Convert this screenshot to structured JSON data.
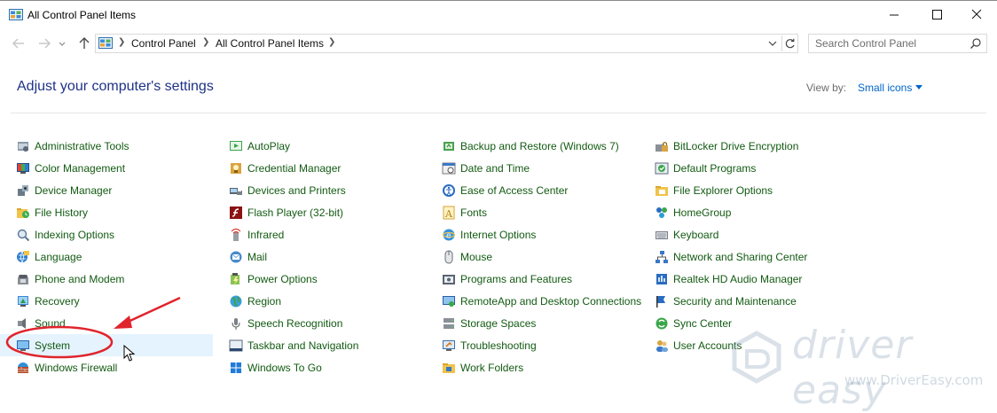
{
  "window": {
    "title": "All Control Panel Items",
    "controls": [
      "minimize-icon",
      "maximize-icon",
      "close-icon"
    ]
  },
  "address": {
    "breadcrumbs": [
      "Control Panel",
      "All Control Panel Items"
    ],
    "search_placeholder": "Search Control Panel"
  },
  "header": {
    "heading": "Adjust your computer's settings",
    "view_by_label": "View by:",
    "view_by_value": "Small icons"
  },
  "columns": [
    [
      {
        "label": "Administrative Tools",
        "icon": "admin-tools-icon"
      },
      {
        "label": "Color Management",
        "icon": "color-management-icon"
      },
      {
        "label": "Device Manager",
        "icon": "device-manager-icon"
      },
      {
        "label": "File History",
        "icon": "file-history-icon"
      },
      {
        "label": "Indexing Options",
        "icon": "indexing-options-icon"
      },
      {
        "label": "Language",
        "icon": "language-icon"
      },
      {
        "label": "Phone and Modem",
        "icon": "phone-modem-icon"
      },
      {
        "label": "Recovery",
        "icon": "recovery-icon"
      },
      {
        "label": "Sound",
        "icon": "sound-icon"
      },
      {
        "label": "System",
        "icon": "system-icon",
        "selected": true
      },
      {
        "label": "Windows Firewall",
        "icon": "firewall-icon"
      }
    ],
    [
      {
        "label": "AutoPlay",
        "icon": "autoplay-icon"
      },
      {
        "label": "Credential Manager",
        "icon": "credential-manager-icon"
      },
      {
        "label": "Devices and Printers",
        "icon": "devices-printers-icon"
      },
      {
        "label": "Flash Player (32-bit)",
        "icon": "flash-player-icon"
      },
      {
        "label": "Infrared",
        "icon": "infrared-icon"
      },
      {
        "label": "Mail",
        "icon": "mail-icon"
      },
      {
        "label": "Power Options",
        "icon": "power-options-icon"
      },
      {
        "label": "Region",
        "icon": "region-icon"
      },
      {
        "label": "Speech Recognition",
        "icon": "speech-recognition-icon"
      },
      {
        "label": "Taskbar and Navigation",
        "icon": "taskbar-icon"
      },
      {
        "label": "Windows To Go",
        "icon": "windows-to-go-icon"
      }
    ],
    [
      {
        "label": "Backup and Restore (Windows 7)",
        "icon": "backup-restore-icon"
      },
      {
        "label": "Date and Time",
        "icon": "date-time-icon"
      },
      {
        "label": "Ease of Access Center",
        "icon": "ease-of-access-icon"
      },
      {
        "label": "Fonts",
        "icon": "fonts-icon"
      },
      {
        "label": "Internet Options",
        "icon": "internet-options-icon"
      },
      {
        "label": "Mouse",
        "icon": "mouse-icon"
      },
      {
        "label": "Programs and Features",
        "icon": "programs-features-icon"
      },
      {
        "label": "RemoteApp and Desktop Connections",
        "icon": "remoteapp-icon"
      },
      {
        "label": "Storage Spaces",
        "icon": "storage-spaces-icon"
      },
      {
        "label": "Troubleshooting",
        "icon": "troubleshooting-icon"
      },
      {
        "label": "Work Folders",
        "icon": "work-folders-icon"
      }
    ],
    [
      {
        "label": "BitLocker Drive Encryption",
        "icon": "bitlocker-icon"
      },
      {
        "label": "Default Programs",
        "icon": "default-programs-icon"
      },
      {
        "label": "File Explorer Options",
        "icon": "file-explorer-options-icon"
      },
      {
        "label": "HomeGroup",
        "icon": "homegroup-icon"
      },
      {
        "label": "Keyboard",
        "icon": "keyboard-icon"
      },
      {
        "label": "Network and Sharing Center",
        "icon": "network-sharing-icon"
      },
      {
        "label": "Realtek HD Audio Manager",
        "icon": "realtek-audio-icon"
      },
      {
        "label": "Security and Maintenance",
        "icon": "security-maintenance-icon"
      },
      {
        "label": "Sync Center",
        "icon": "sync-center-icon"
      },
      {
        "label": "User Accounts",
        "icon": "user-accounts-icon"
      }
    ]
  ],
  "watermark": {
    "title": "driver easy",
    "url": "www.DriverEasy.com"
  },
  "colors": {
    "link_green": "#125a12",
    "heading_blue": "#1e3287",
    "selection": "#e5f3ff",
    "annotation_red": "#e0242b"
  }
}
